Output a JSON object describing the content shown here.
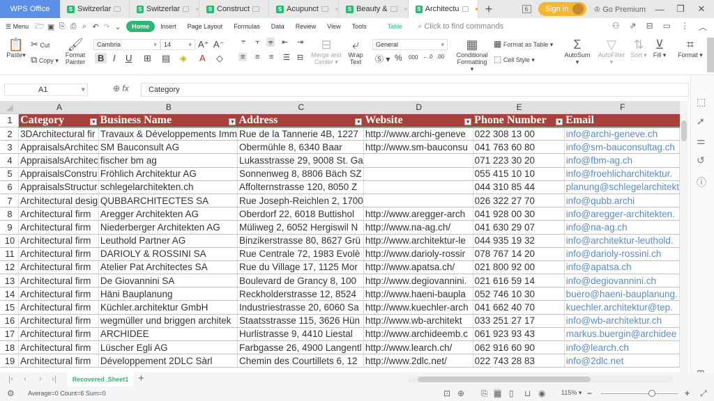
{
  "titlebar": {
    "app_tab": "WPS Office",
    "tabs": [
      {
        "label": "Switzerlar",
        "active": false
      },
      {
        "label": "Switzerlar",
        "active": false
      },
      {
        "label": "Construct",
        "active": false
      },
      {
        "label": "Acupunct",
        "active": false
      },
      {
        "label": "Beauty &",
        "active": false
      },
      {
        "label": "Architectu",
        "active": true
      }
    ],
    "new_tab": "+",
    "window_count": "6",
    "sign_in": "Sign in",
    "go_premium": "Go Premium",
    "minimize": "—",
    "restore": "❐",
    "close": "✕"
  },
  "menubar": {
    "menu": "Menu",
    "tabs": [
      "Home",
      "Insert",
      "Page Layout",
      "Formulas",
      "Data",
      "Review",
      "View",
      "Tools"
    ],
    "table_tab": "Table",
    "search_placeholder": "Click to find commands"
  },
  "ribbon": {
    "paste": "Paste",
    "cut": "Cut",
    "copy": "Copy",
    "format_painter": [
      "Format",
      "Painter"
    ],
    "font_name": "Cambria",
    "font_size": "14",
    "merge_center": [
      "Merge and",
      "Center"
    ],
    "wrap_text": [
      "Wrap",
      "Text"
    ],
    "number_format": "General",
    "conditional_formatting": [
      "Conditional",
      "Formatting"
    ],
    "format_as_table": "Format as Table",
    "cell_style": "Cell Style",
    "autosum": "AutoSum",
    "autofilter": "AutoFilter",
    "sort": "Sort",
    "fill": "Fill",
    "format": "Format"
  },
  "formula_bar": {
    "cell_ref": "A1",
    "fx": "fx",
    "value": "Category"
  },
  "grid": {
    "columns": [
      "A",
      "B",
      "C",
      "D",
      "E",
      "F"
    ],
    "headers": [
      "Category",
      "Business Name",
      "Address",
      "Website",
      "Phone Number",
      "Email"
    ],
    "rows": [
      {
        "n": "2",
        "cells": [
          "3DArchitectural fir",
          "Travaux & Développements Imm",
          "Rue de la Tannerie 4B, 1227",
          "http://www.archi-geneve",
          "022 308 13 00",
          "info@archi-geneve.ch"
        ]
      },
      {
        "n": "3",
        "cells": [
          "AppraisalsArchitec",
          "SM Bauconsult AG",
          "Obermühle 8, 6340 Baar",
          "http://www.sm-bauconsu",
          "041 763 60 80",
          "info@sm-bauconsultag.ch"
        ]
      },
      {
        "n": "4",
        "cells": [
          "AppraisalsArchitec",
          "fischer bm ag",
          "Lukasstrasse 29, 9008 St. Ga",
          "",
          "071 223 30 20",
          "info@fbm-ag.ch"
        ]
      },
      {
        "n": "5",
        "cells": [
          "AppraisalsConstru",
          "Fröhlich Architektur AG",
          "Sonnenweg 8, 8806 Bäch SZ",
          "",
          "055 415 10 10",
          "info@froehlicharchitektur."
        ]
      },
      {
        "n": "6",
        "cells": [
          "AppraisalsStructur",
          "schlegelarchitekten.ch",
          "Affolternstrasse 120, 8050 Z",
          "",
          "044 310 85 44",
          "planung@schlegelarchitekt"
        ]
      },
      {
        "n": "7",
        "cells": [
          "Architectural desig",
          "QUBBARCHITECTES SA",
          "Rue Joseph-Reichlen 2, 1700",
          "",
          "026 322 27 70",
          "info@qubb.archi"
        ]
      },
      {
        "n": "8",
        "cells": [
          "Architectural firm",
          "Aregger Architekten AG",
          "Oberdorf 22, 6018 Buttishol",
          "http://www.aregger-arch",
          "041 928 00 30",
          "info@aregger-architekten."
        ]
      },
      {
        "n": "9",
        "cells": [
          "Architectural firm",
          "Niederberger Architekten AG",
          "Müliweg 2, 6052 Hergiswil N",
          "http://www.na-ag.ch/",
          "041 630 29 07",
          "info@na-ag.ch"
        ]
      },
      {
        "n": "10",
        "cells": [
          "Architectural firm",
          "Leuthold Partner AG",
          "Binzikerstrasse 80, 8627 Grü",
          "http://www.architektur-le",
          "044 935 19 32",
          "info@architektur-leuthold."
        ]
      },
      {
        "n": "11",
        "cells": [
          "Architectural firm",
          "DARIOLY & ROSSINI SA",
          "Rue Centrale 72, 1983 Evolè",
          "http://www.darioly-rossir",
          "078 767 14 20",
          "info@darioly-rossini.ch"
        ]
      },
      {
        "n": "12",
        "cells": [
          "Architectural firm",
          "Atelier Pat Architectes SA",
          "Rue du Village 17, 1125 Mor",
          "http://www.apatsa.ch/",
          "021 800 92 00",
          "info@apatsa.ch"
        ]
      },
      {
        "n": "13",
        "cells": [
          "Architectural firm",
          "De Giovannini SA",
          "Boulevard de Grancy 8, 100",
          "http://www.degiovannini.",
          "021 616 59 14",
          "info@degiovannini.ch"
        ]
      },
      {
        "n": "14",
        "cells": [
          "Architectural firm",
          "Häni Bauplanung",
          "Reckholderstrasse 12, 8524",
          "http://www.haeni-baupla",
          "052 746 10 30",
          "buero@haeni-bauplanung."
        ]
      },
      {
        "n": "15",
        "cells": [
          "Architectural firm",
          "Küchler.architektur GmbH",
          "Industriestrasse 20, 6060 Sa",
          "http://www.kuechler-arch",
          "041 662 40 70",
          "kuechler.architektur@tep."
        ]
      },
      {
        "n": "16",
        "cells": [
          "Architectural firm",
          "wegmüller und briggen architek",
          "Staatsstrasse 115, 3626 Hün",
          "http://www.wb-architekt",
          "033 251 27 17",
          "info@wb-architektur.ch"
        ]
      },
      {
        "n": "17",
        "cells": [
          "Architectural firm",
          "ARCHIDEE",
          "Hurlistrasse 9, 4410 Liestal",
          "http://www.archideemb.c",
          "061 923 93 43",
          "markus.buergin@archidee"
        ]
      },
      {
        "n": "18",
        "cells": [
          "Architectural firm",
          "Lüscher Egli AG",
          "Farbgasse 26, 4900 Langentl",
          "http://www.learch.ch/",
          "062 916 60 90",
          "info@learch.ch"
        ]
      },
      {
        "n": "19",
        "cells": [
          "Architectural firm",
          "Développement 2DLC Sàrl",
          "Chemin des Courtillets 6, 12",
          "http://www.2dlc.net/",
          "022 743 28 83",
          "info@2dlc.net"
        ]
      }
    ]
  },
  "sheets": {
    "tabs": [
      "Recovered_Sheet1"
    ],
    "add": "+"
  },
  "status": {
    "summary": "Average=0  Count=6  Sum=0",
    "zoom": "115%",
    "zoom_level_percent": 115
  },
  "colors": {
    "accent": "#2bb673",
    "header_fill": "#a8403c",
    "email_text": "#5a8dc4"
  }
}
